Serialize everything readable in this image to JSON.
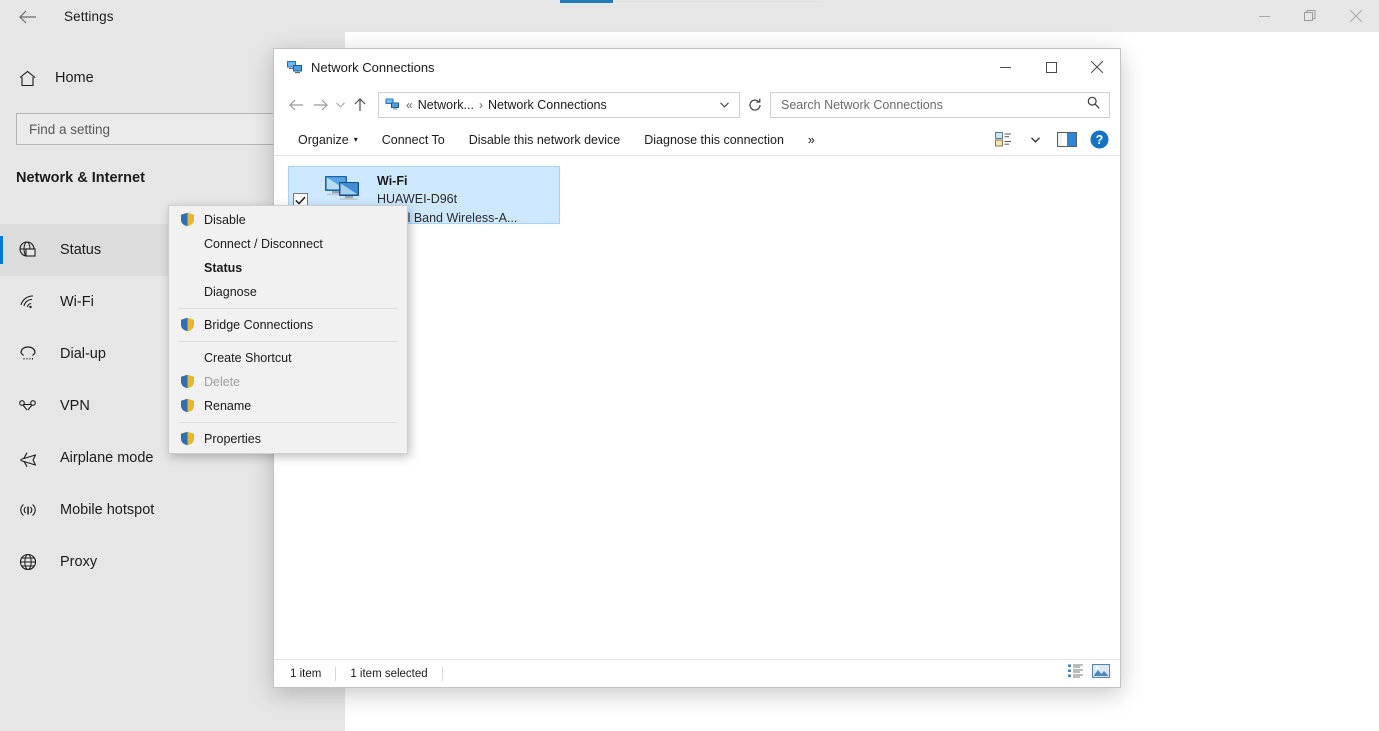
{
  "settings": {
    "title": "Settings",
    "back_icon": "back-arrow-icon",
    "window_controls": {
      "minimize": "minimize-icon",
      "restore": "restore-icon",
      "close": "close-icon"
    },
    "home_label": "Home",
    "home_icon": "home-icon",
    "search": {
      "placeholder": "Find a setting",
      "value": ""
    },
    "category_title": "Network & Internet",
    "accent_color": "#0078d4",
    "nav_items": [
      {
        "label": "Status",
        "icon": "globe-status-icon",
        "selected": true
      },
      {
        "label": "Wi-Fi",
        "icon": "wifi-icon",
        "selected": false
      },
      {
        "label": "Dial-up",
        "icon": "dialup-icon",
        "selected": false
      },
      {
        "label": "VPN",
        "icon": "vpn-icon",
        "selected": false
      },
      {
        "label": "Airplane mode",
        "icon": "airplane-icon",
        "selected": false
      },
      {
        "label": "Mobile hotspot",
        "icon": "hotspot-icon",
        "selected": false
      },
      {
        "label": "Proxy",
        "icon": "proxy-globe-icon",
        "selected": false
      }
    ]
  },
  "explorer": {
    "title": "Network Connections",
    "title_icon": "network-connections-icon",
    "window_controls": {
      "minimize": "minimize-icon",
      "maximize": "maximize-icon",
      "close": "close-icon"
    },
    "nav": {
      "back": "back-arrow-icon",
      "forward": "forward-arrow-icon",
      "recent": "chevron-down-icon",
      "up": "up-arrow-icon",
      "refresh": "refresh-icon"
    },
    "breadcrumb": {
      "icon": "network-icon",
      "chevrons": "«",
      "parent": "Network...",
      "separator": "›",
      "current": "Network Connections",
      "caret": "chevron-down-icon"
    },
    "search": {
      "placeholder": "Search Network Connections",
      "value": "",
      "icon": "search-icon"
    },
    "toolbar": {
      "organize": "Organize",
      "organize_caret": "▾",
      "connect_to": "Connect To",
      "disable_device": "Disable this network device",
      "diagnose": "Diagnose this connection",
      "overflow": "»",
      "view_icon": "change-view-icon",
      "view_caret": "▾",
      "preview_icon": "preview-pane-icon",
      "help_icon": "help-icon"
    },
    "connection": {
      "name": "Wi-Fi",
      "network": "HUAWEI-D96t",
      "adapter": ") Dual Band Wireless-A...",
      "checked": true,
      "check_icon": "checkmark-icon",
      "device_icon": "network-adapter-icon"
    },
    "status_bar": {
      "item_count": "1 item",
      "selection": "1 item selected",
      "details_view_icon": "details-view-icon",
      "large_icons_view_icon": "large-icons-view-icon"
    }
  },
  "context_menu": {
    "items": [
      {
        "label": "Disable",
        "shield": true,
        "bold": false,
        "disabled": false,
        "sep_after": false
      },
      {
        "label": "Connect / Disconnect",
        "shield": false,
        "bold": false,
        "disabled": false,
        "sep_after": false
      },
      {
        "label": "Status",
        "shield": false,
        "bold": true,
        "disabled": false,
        "sep_after": false
      },
      {
        "label": "Diagnose",
        "shield": false,
        "bold": false,
        "disabled": false,
        "sep_after": true
      },
      {
        "label": "Bridge Connections",
        "shield": true,
        "bold": false,
        "disabled": false,
        "sep_after": true
      },
      {
        "label": "Create Shortcut",
        "shield": false,
        "bold": false,
        "disabled": false,
        "sep_after": false
      },
      {
        "label": "Delete",
        "shield": true,
        "bold": false,
        "disabled": true,
        "sep_after": false
      },
      {
        "label": "Rename",
        "shield": true,
        "bold": false,
        "disabled": false,
        "sep_after": true
      },
      {
        "label": "Properties",
        "shield": true,
        "bold": false,
        "disabled": false,
        "sep_after": false
      }
    ]
  }
}
